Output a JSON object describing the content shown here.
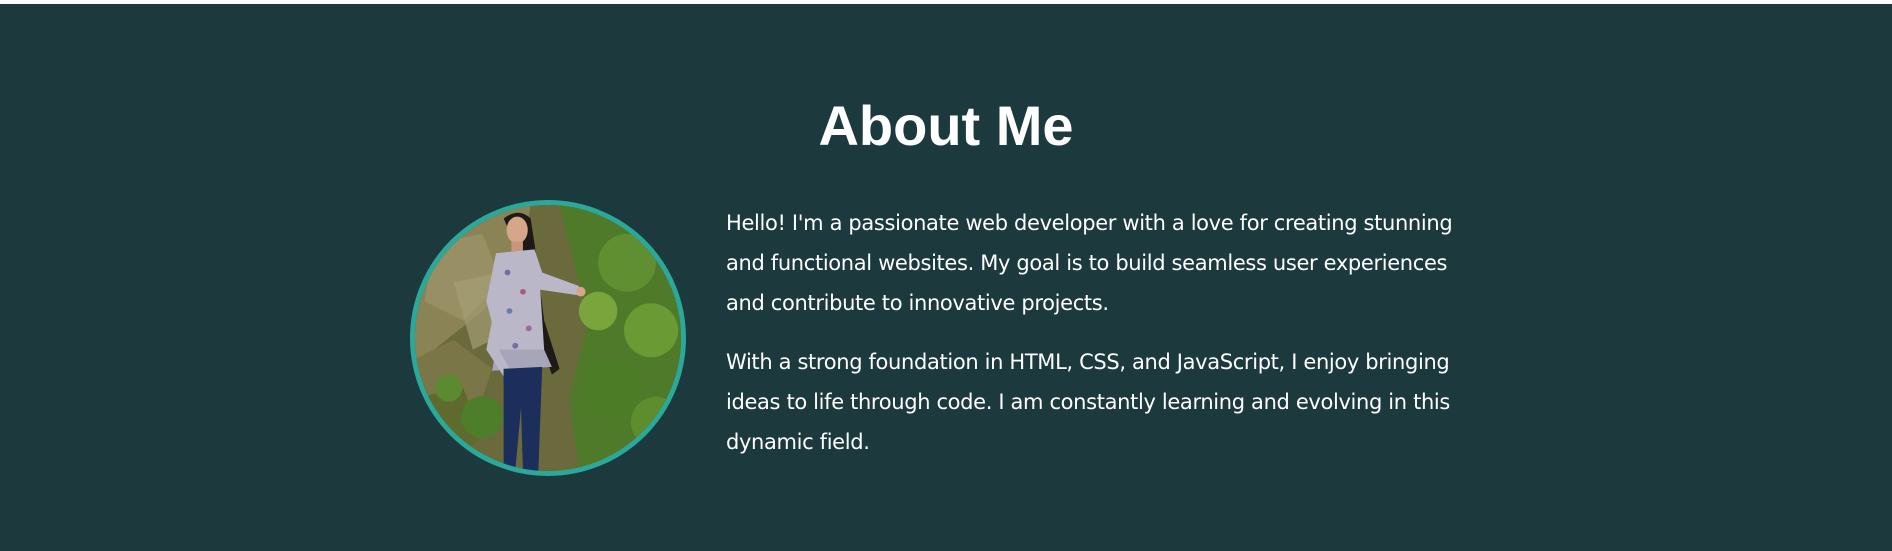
{
  "about": {
    "title": "About Me",
    "photo_icon": "profile-photo",
    "paragraphs": [
      "Hello! I'm a passionate web developer with a love for creating stunning and functional websites. My goal is to build seamless user experiences and contribute to innovative projects.",
      "With a strong foundation in HTML, CSS, and JavaScript, I enjoy bringing ideas to life through code. I am constantly learning and evolving in this dynamic field."
    ]
  },
  "colors": {
    "background": "#1c3a3d",
    "accent_border": "#2aa89a",
    "text": "#ffffff"
  }
}
